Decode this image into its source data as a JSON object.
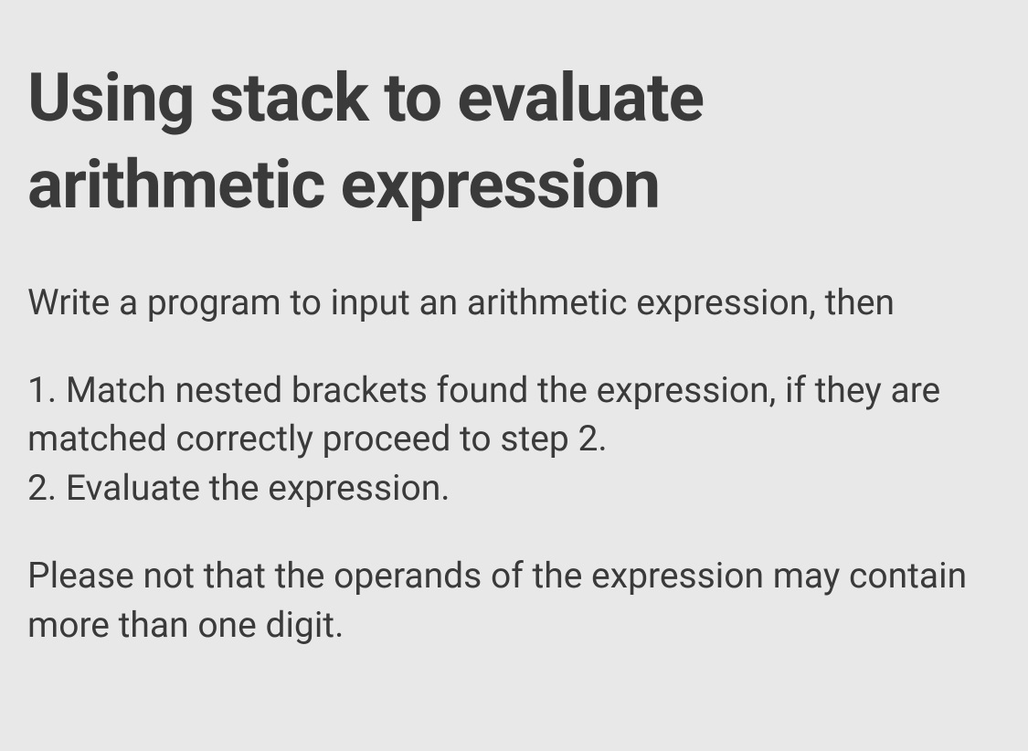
{
  "title": "Using stack to evaluate arithmetic expression",
  "paragraphs": [
    "Write a program to input an arithmetic expression, then",
    "1. Match nested brackets found the expression, if they are matched correctly proceed to step 2.\n2. Evaluate the expression.",
    "Please not that the operands of the expression may contain more than one digit."
  ]
}
